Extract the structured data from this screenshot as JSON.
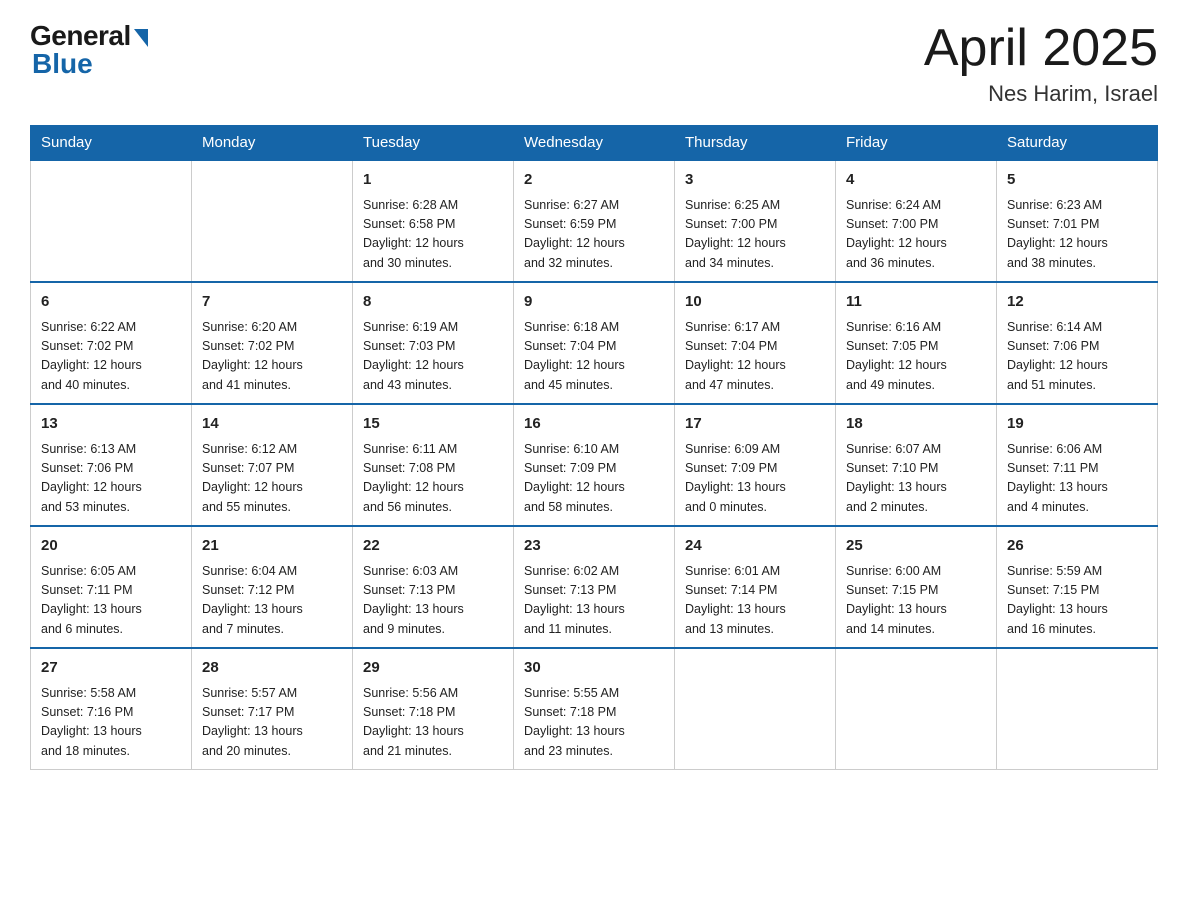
{
  "logo": {
    "general": "General",
    "blue": "Blue"
  },
  "title": "April 2025",
  "location": "Nes Harim, Israel",
  "days_of_week": [
    "Sunday",
    "Monday",
    "Tuesday",
    "Wednesday",
    "Thursday",
    "Friday",
    "Saturday"
  ],
  "weeks": [
    [
      {
        "day": "",
        "info": ""
      },
      {
        "day": "",
        "info": ""
      },
      {
        "day": "1",
        "info": "Sunrise: 6:28 AM\nSunset: 6:58 PM\nDaylight: 12 hours\nand 30 minutes."
      },
      {
        "day": "2",
        "info": "Sunrise: 6:27 AM\nSunset: 6:59 PM\nDaylight: 12 hours\nand 32 minutes."
      },
      {
        "day": "3",
        "info": "Sunrise: 6:25 AM\nSunset: 7:00 PM\nDaylight: 12 hours\nand 34 minutes."
      },
      {
        "day": "4",
        "info": "Sunrise: 6:24 AM\nSunset: 7:00 PM\nDaylight: 12 hours\nand 36 minutes."
      },
      {
        "day": "5",
        "info": "Sunrise: 6:23 AM\nSunset: 7:01 PM\nDaylight: 12 hours\nand 38 minutes."
      }
    ],
    [
      {
        "day": "6",
        "info": "Sunrise: 6:22 AM\nSunset: 7:02 PM\nDaylight: 12 hours\nand 40 minutes."
      },
      {
        "day": "7",
        "info": "Sunrise: 6:20 AM\nSunset: 7:02 PM\nDaylight: 12 hours\nand 41 minutes."
      },
      {
        "day": "8",
        "info": "Sunrise: 6:19 AM\nSunset: 7:03 PM\nDaylight: 12 hours\nand 43 minutes."
      },
      {
        "day": "9",
        "info": "Sunrise: 6:18 AM\nSunset: 7:04 PM\nDaylight: 12 hours\nand 45 minutes."
      },
      {
        "day": "10",
        "info": "Sunrise: 6:17 AM\nSunset: 7:04 PM\nDaylight: 12 hours\nand 47 minutes."
      },
      {
        "day": "11",
        "info": "Sunrise: 6:16 AM\nSunset: 7:05 PM\nDaylight: 12 hours\nand 49 minutes."
      },
      {
        "day": "12",
        "info": "Sunrise: 6:14 AM\nSunset: 7:06 PM\nDaylight: 12 hours\nand 51 minutes."
      }
    ],
    [
      {
        "day": "13",
        "info": "Sunrise: 6:13 AM\nSunset: 7:06 PM\nDaylight: 12 hours\nand 53 minutes."
      },
      {
        "day": "14",
        "info": "Sunrise: 6:12 AM\nSunset: 7:07 PM\nDaylight: 12 hours\nand 55 minutes."
      },
      {
        "day": "15",
        "info": "Sunrise: 6:11 AM\nSunset: 7:08 PM\nDaylight: 12 hours\nand 56 minutes."
      },
      {
        "day": "16",
        "info": "Sunrise: 6:10 AM\nSunset: 7:09 PM\nDaylight: 12 hours\nand 58 minutes."
      },
      {
        "day": "17",
        "info": "Sunrise: 6:09 AM\nSunset: 7:09 PM\nDaylight: 13 hours\nand 0 minutes."
      },
      {
        "day": "18",
        "info": "Sunrise: 6:07 AM\nSunset: 7:10 PM\nDaylight: 13 hours\nand 2 minutes."
      },
      {
        "day": "19",
        "info": "Sunrise: 6:06 AM\nSunset: 7:11 PM\nDaylight: 13 hours\nand 4 minutes."
      }
    ],
    [
      {
        "day": "20",
        "info": "Sunrise: 6:05 AM\nSunset: 7:11 PM\nDaylight: 13 hours\nand 6 minutes."
      },
      {
        "day": "21",
        "info": "Sunrise: 6:04 AM\nSunset: 7:12 PM\nDaylight: 13 hours\nand 7 minutes."
      },
      {
        "day": "22",
        "info": "Sunrise: 6:03 AM\nSunset: 7:13 PM\nDaylight: 13 hours\nand 9 minutes."
      },
      {
        "day": "23",
        "info": "Sunrise: 6:02 AM\nSunset: 7:13 PM\nDaylight: 13 hours\nand 11 minutes."
      },
      {
        "day": "24",
        "info": "Sunrise: 6:01 AM\nSunset: 7:14 PM\nDaylight: 13 hours\nand 13 minutes."
      },
      {
        "day": "25",
        "info": "Sunrise: 6:00 AM\nSunset: 7:15 PM\nDaylight: 13 hours\nand 14 minutes."
      },
      {
        "day": "26",
        "info": "Sunrise: 5:59 AM\nSunset: 7:15 PM\nDaylight: 13 hours\nand 16 minutes."
      }
    ],
    [
      {
        "day": "27",
        "info": "Sunrise: 5:58 AM\nSunset: 7:16 PM\nDaylight: 13 hours\nand 18 minutes."
      },
      {
        "day": "28",
        "info": "Sunrise: 5:57 AM\nSunset: 7:17 PM\nDaylight: 13 hours\nand 20 minutes."
      },
      {
        "day": "29",
        "info": "Sunrise: 5:56 AM\nSunset: 7:18 PM\nDaylight: 13 hours\nand 21 minutes."
      },
      {
        "day": "30",
        "info": "Sunrise: 5:55 AM\nSunset: 7:18 PM\nDaylight: 13 hours\nand 23 minutes."
      },
      {
        "day": "",
        "info": ""
      },
      {
        "day": "",
        "info": ""
      },
      {
        "day": "",
        "info": ""
      }
    ]
  ]
}
